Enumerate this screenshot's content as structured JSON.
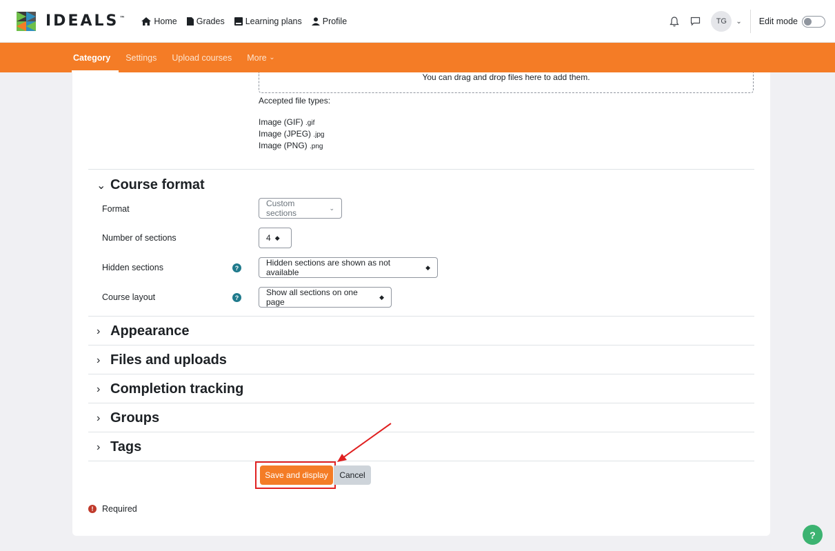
{
  "brand": {
    "name": "IDEALS",
    "tm": "™"
  },
  "primary_nav": [
    {
      "label": "Home",
      "icon": "home-icon"
    },
    {
      "label": "Grades",
      "icon": "document-icon"
    },
    {
      "label": "Learning plans",
      "icon": "book-icon"
    },
    {
      "label": "Profile",
      "icon": "user-icon"
    }
  ],
  "user": {
    "initials": "TG"
  },
  "edit_mode": {
    "label": "Edit mode",
    "on": false
  },
  "secondary_nav": [
    {
      "label": "Category",
      "active": true
    },
    {
      "label": "Settings",
      "active": false
    },
    {
      "label": "Upload courses",
      "active": false
    },
    {
      "label": "More",
      "active": false,
      "caret": "⌄"
    }
  ],
  "filepicker": {
    "drop_text": "You can drag and drop files here to add them."
  },
  "accepted": {
    "label": "Accepted file types:",
    "types": [
      {
        "name": "Image (GIF)",
        "ext": ".gif"
      },
      {
        "name": "Image (JPEG)",
        "ext": ".jpg"
      },
      {
        "name": "Image (PNG)",
        "ext": ".png"
      }
    ]
  },
  "course_format": {
    "title": "Course format",
    "fields": [
      {
        "label": "Format",
        "value": "Custom sections",
        "help": false
      },
      {
        "label": "Number of sections",
        "value": "4",
        "help": false
      },
      {
        "label": "Hidden sections",
        "value": "Hidden sections are shown as not available",
        "help": true
      },
      {
        "label": "Course layout",
        "value": "Show all sections on one page",
        "help": true
      }
    ]
  },
  "collapsed_sections": [
    "Appearance",
    "Files and uploads",
    "Completion tracking",
    "Groups",
    "Tags"
  ],
  "buttons": {
    "save": "Save and display",
    "cancel": "Cancel"
  },
  "required": {
    "label": "Required",
    "icon_glyph": "!"
  },
  "help_fab": {
    "glyph": "?"
  },
  "help_glyph": "?",
  "colors": {
    "brand_orange": "#f47c26",
    "annotation_red": "#e02020",
    "help_teal": "#1f7a8c"
  }
}
